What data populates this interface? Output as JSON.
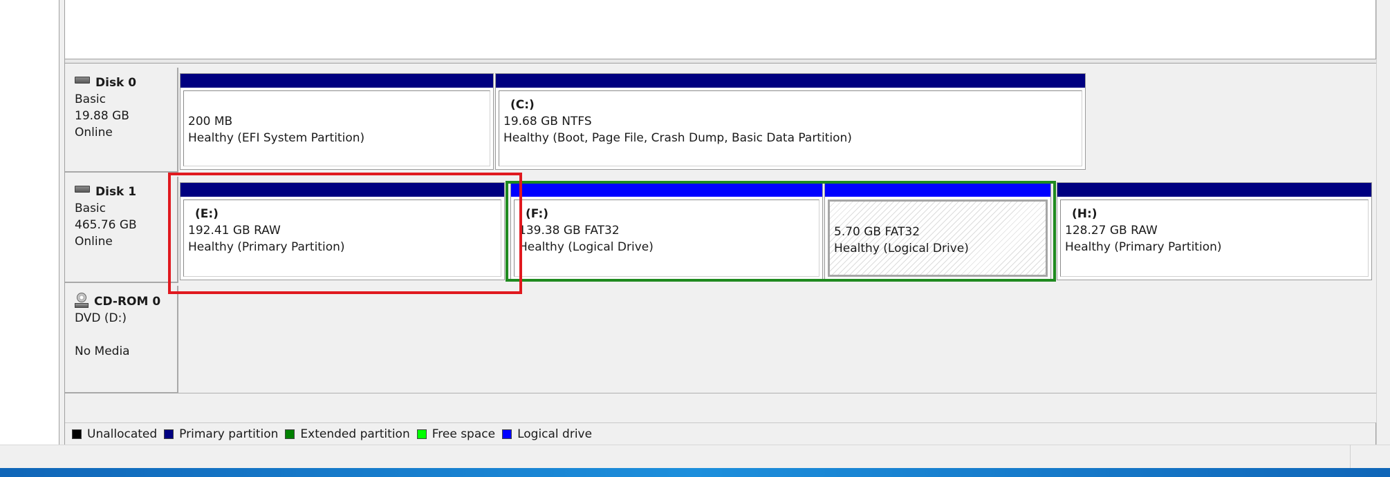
{
  "disks": [
    {
      "name": "Disk 0",
      "type": "Basic",
      "size": "19.88 GB",
      "status": "Online",
      "icon": "hard-disk-icon",
      "partitions": [
        {
          "volume": "",
          "size_fs": "200 MB",
          "health": "Healthy (EFI System Partition)",
          "kind": "primary"
        },
        {
          "volume": "(C:)",
          "size_fs": "19.68 GB NTFS",
          "health": "Healthy (Boot, Page File, Crash Dump, Basic Data Partition)",
          "kind": "primary"
        }
      ]
    },
    {
      "name": "Disk 1",
      "type": "Basic",
      "size": "465.76 GB",
      "status": "Online",
      "icon": "hard-disk-icon",
      "partitions": [
        {
          "volume": "(E:)",
          "size_fs": "192.41 GB RAW",
          "health": "Healthy (Primary Partition)",
          "kind": "primary"
        },
        {
          "volume": "(F:)",
          "size_fs": "139.38 GB FAT32",
          "health": "Healthy (Logical Drive)",
          "kind": "logical"
        },
        {
          "volume": "",
          "size_fs": "5.70 GB FAT32",
          "health": "Healthy (Logical Drive)",
          "kind": "logical",
          "selected": true
        },
        {
          "volume": "(H:)",
          "size_fs": "128.27 GB RAW",
          "health": "Healthy (Primary Partition)",
          "kind": "primary"
        }
      ]
    },
    {
      "name": "CD-ROM 0",
      "type": "DVD (D:)",
      "size": "",
      "status": "No Media",
      "icon": "cd-rom-icon"
    }
  ],
  "legend": [
    {
      "label": "Unallocated",
      "color": "#000000"
    },
    {
      "label": "Primary partition",
      "color": "#000080"
    },
    {
      "label": "Extended partition",
      "color": "#008000"
    },
    {
      "label": "Free space",
      "color": "#00ff00"
    },
    {
      "label": "Logical drive",
      "color": "#0000ff"
    }
  ],
  "colors": {
    "primary_bar": "#000080",
    "logical_bar": "#0000ff",
    "annotation_red": "#e0191f",
    "annotation_green": "#1f8a1f"
  }
}
